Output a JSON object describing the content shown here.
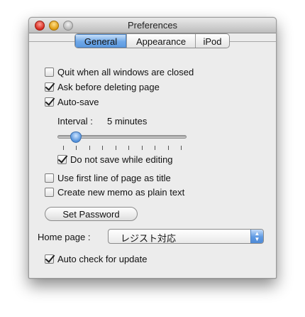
{
  "window": {
    "title": "Preferences"
  },
  "tabs": [
    {
      "label": "General",
      "active": true
    },
    {
      "label": "Appearance",
      "active": false
    },
    {
      "label": "iPod",
      "active": false
    }
  ],
  "options": {
    "quit_when_closed": {
      "label": "Quit when all windows are closed",
      "checked": false
    },
    "ask_before_delete": {
      "label": "Ask before deleting page",
      "checked": true
    },
    "auto_save": {
      "label": "Auto-save",
      "checked": true
    },
    "do_not_save_editing": {
      "label": "Do not save while editing",
      "checked": true
    },
    "first_line_title": {
      "label": "Use first line of page as title",
      "checked": false
    },
    "plain_text_memo": {
      "label": "Create new memo as plain text",
      "checked": false
    },
    "auto_update": {
      "label": "Auto check for update",
      "checked": true
    }
  },
  "interval": {
    "label": "Interval :",
    "value_text": "5 minutes",
    "slider_position": 0.11,
    "tick_count": 10
  },
  "set_password": {
    "label": "Set Password"
  },
  "home_page": {
    "label": "Home page :",
    "selected": "レジスト対応"
  },
  "colors": {
    "accent": "#5b99e0",
    "window_bg": "#ececec"
  }
}
